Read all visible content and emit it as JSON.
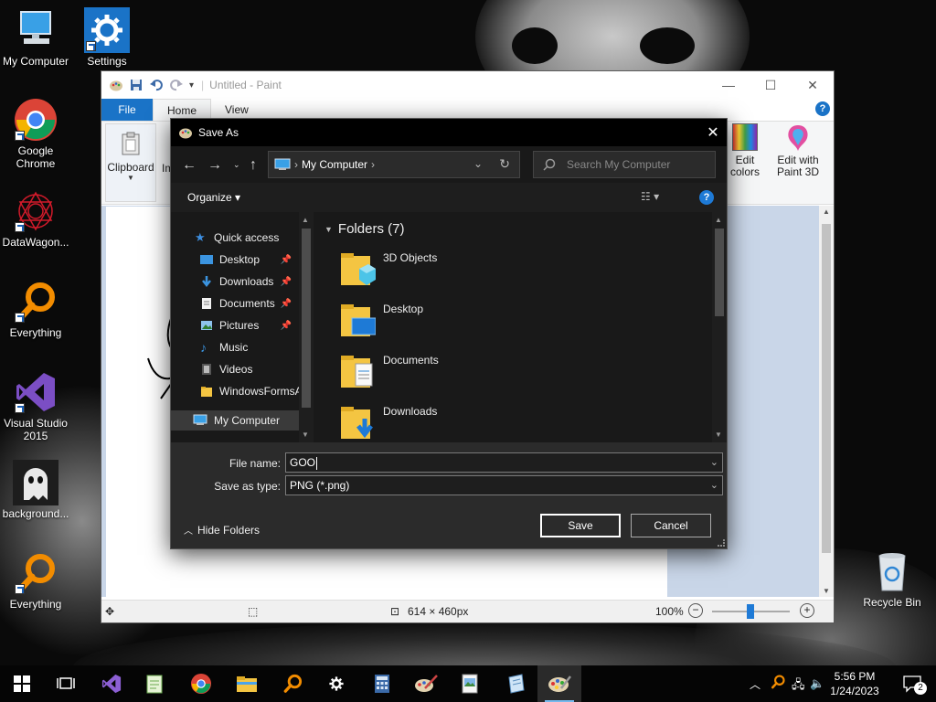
{
  "desktop": {
    "icons": [
      {
        "label": "My Computer"
      },
      {
        "label": "Settings"
      },
      {
        "label": "Google Chrome"
      },
      {
        "label": "DataWagon..."
      },
      {
        "label": "Everything"
      },
      {
        "label": "Visual Studio 2015"
      },
      {
        "label": "background..."
      },
      {
        "label": "Everything"
      }
    ],
    "recycle_bin": "Recycle Bin"
  },
  "paint": {
    "title": "Untitled - Paint",
    "tabs": {
      "file": "File",
      "home": "Home",
      "view": "View"
    },
    "ribbon": {
      "clipboard": "Clipboard",
      "image_partial": "Im",
      "edit_colors_1": "Edit",
      "edit_colors_2": "colors",
      "paint3d_1": "Edit with",
      "paint3d_2": "Paint 3D"
    },
    "status": {
      "size": "614 × 460px",
      "zoom": "100%"
    }
  },
  "dialog": {
    "title": "Save As",
    "address": "My Computer",
    "search_placeholder": "Search My Computer",
    "organize": "Organize",
    "nav": {
      "quick_access": "Quick access",
      "items": [
        {
          "label": "Desktop",
          "pinned": true
        },
        {
          "label": "Downloads",
          "pinned": true
        },
        {
          "label": "Documents",
          "pinned": true
        },
        {
          "label": "Pictures",
          "pinned": true
        },
        {
          "label": "Music",
          "pinned": false
        },
        {
          "label": "Videos",
          "pinned": false
        },
        {
          "label": "WindowsFormsA",
          "pinned": false
        }
      ],
      "my_computer": "My Computer"
    },
    "folders_header": "Folders (7)",
    "folders": [
      "3D Objects",
      "Desktop",
      "Documents",
      "Downloads"
    ],
    "file_name_label": "File name:",
    "file_name_value": "GOO",
    "save_type_label": "Save as type:",
    "save_type_value": "PNG (*.png)",
    "hide_folders": "Hide Folders",
    "save_button": "Save",
    "cancel_button": "Cancel"
  },
  "taskbar": {
    "time": "5:56 PM",
    "date": "1/24/2023",
    "notification_count": "2"
  },
  "colors": {
    "accent": "#1a73c7",
    "folder_yellow": "#f4c542",
    "dialog_bg": "#2b2b2b"
  }
}
